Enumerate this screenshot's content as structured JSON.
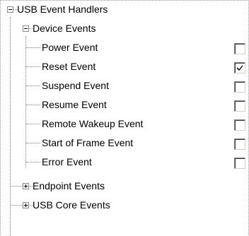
{
  "tree": {
    "root": {
      "label": "USB Event Handlers",
      "expanded": true
    },
    "device_events": {
      "label": "Device Events",
      "expanded": true,
      "items": [
        {
          "label": "Power Event",
          "checked": false
        },
        {
          "label": "Reset Event",
          "checked": true
        },
        {
          "label": "Suspend Event",
          "checked": false
        },
        {
          "label": "Resume Event",
          "checked": false
        },
        {
          "label": "Remote Wakeup Event",
          "checked": false
        },
        {
          "label": "Start of Frame Event",
          "checked": false
        },
        {
          "label": "Error Event",
          "checked": false
        }
      ]
    },
    "endpoint_events": {
      "label": "Endpoint Events",
      "expanded": false
    },
    "usb_core_events": {
      "label": "USB Core Events",
      "expanded": false
    }
  }
}
